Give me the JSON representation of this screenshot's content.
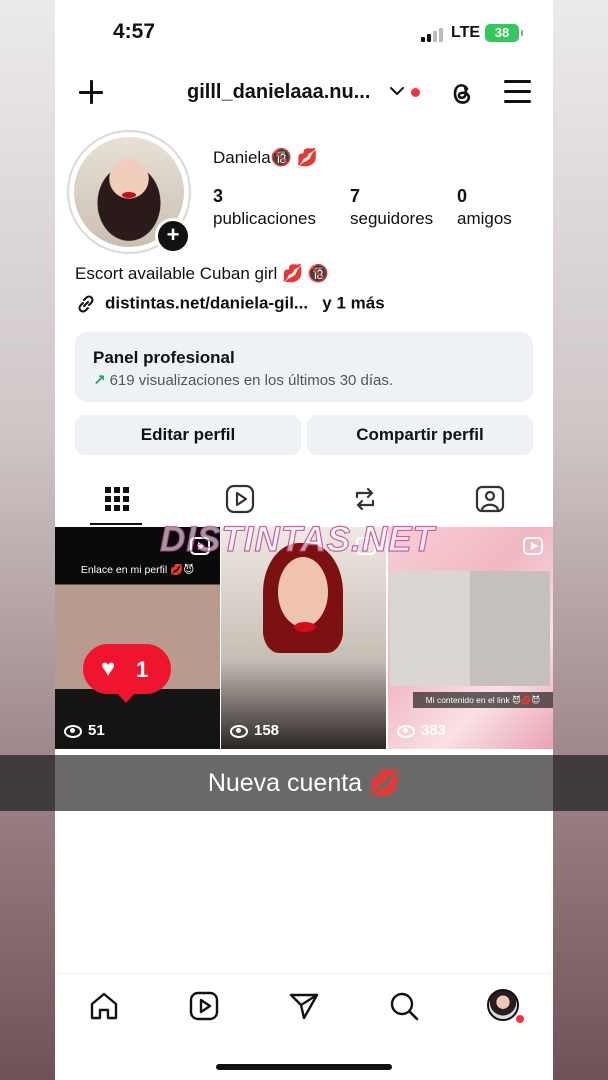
{
  "status_bar": {
    "time": "4:57",
    "network": "LTE",
    "battery": "38"
  },
  "header": {
    "username": "gilll_danielaaa.nu...",
    "create_icon": "plus-icon",
    "threads_icon": "threads-icon",
    "menu_icon": "hamburger-icon"
  },
  "profile": {
    "display_name": "Daniela🔞 💋",
    "stats": [
      {
        "count": "3",
        "label": "publicaciones"
      },
      {
        "count": "7",
        "label": "seguidores"
      },
      {
        "count": "0",
        "label": "amigos"
      }
    ],
    "bio": "Escort available Cuban girl 💋 🔞",
    "link": "distintas.net/daniela-gil...",
    "link_more": "y 1 más"
  },
  "pro_panel": {
    "title": "Panel profesional",
    "subtitle": "619 visualizaciones en los últimos 30 días.",
    "trend_color": "#1ea362"
  },
  "buttons": {
    "edit": "Editar perfil",
    "share": "Compartir perfil"
  },
  "tabs": [
    "grid-icon",
    "reels-icon",
    "reposts-icon",
    "tagged-icon"
  ],
  "posts": [
    {
      "caption": "Enlace en mi perfil 💋😈",
      "views": "51"
    },
    {
      "caption": "",
      "views": "158"
    },
    {
      "caption": "Mi contenido en el link 😈💋😈",
      "views": "383"
    }
  ],
  "like_notification": {
    "count": "1",
    "color": "#f0152f"
  },
  "watermark": "DISTINTAS.NET",
  "banner": "Nueva cuenta 💋",
  "bottom_nav": [
    "home-icon",
    "reels-icon",
    "send-icon",
    "search-icon",
    "profile-avatar"
  ]
}
